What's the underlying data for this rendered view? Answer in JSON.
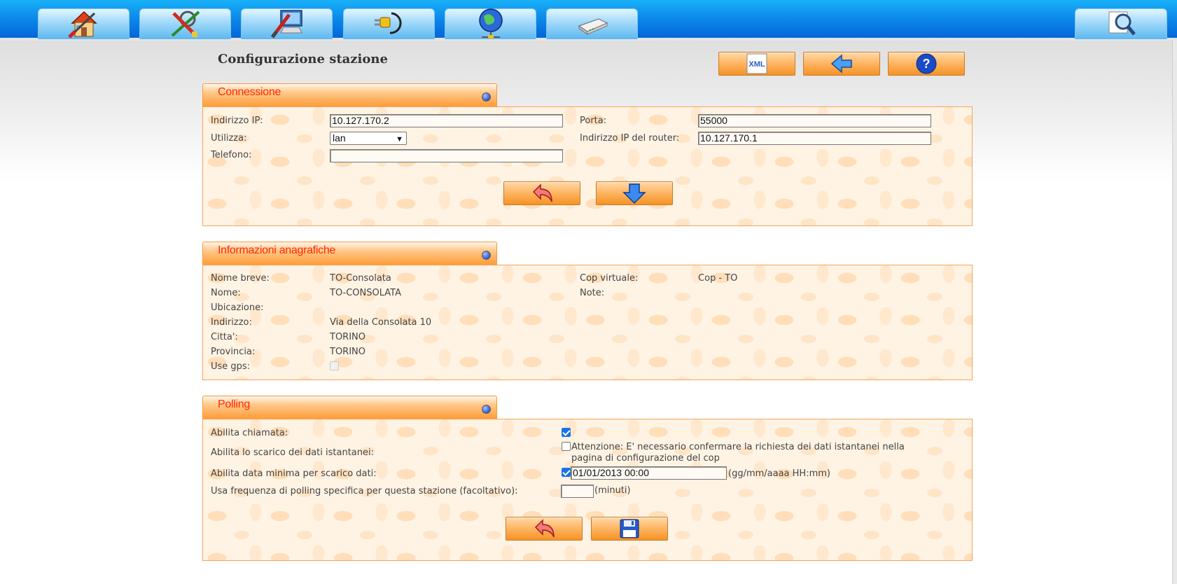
{
  "nav": {
    "tabs": [
      {
        "icon": "home-icon"
      },
      {
        "icon": "tools-icon"
      },
      {
        "icon": "computer-config-icon"
      },
      {
        "icon": "plug-icon"
      },
      {
        "icon": "network-globe-icon"
      },
      {
        "icon": "modem-icon"
      }
    ],
    "search_icon": "magnifier-icon"
  },
  "page": {
    "title": "Configurazione stazione",
    "actions": {
      "xml_label": "XML",
      "back_icon": "arrow-left-icon",
      "help_icon": "help-icon"
    }
  },
  "connessione": {
    "title": "Connessione",
    "ip_label": "Indirizzo IP:",
    "ip_value": "10.127.170.2",
    "porta_label": "Porta:",
    "porta_value": "55000",
    "utilizza_label": "Utilizza:",
    "utilizza_value": "lan",
    "router_label": "Indirizzo IP del router:",
    "router_value": "10.127.170.1",
    "telefono_label": "Telefono:",
    "telefono_value": ""
  },
  "anagrafica": {
    "title": "Informazioni anagrafiche",
    "rows_left": [
      {
        "label": "Nome breve:",
        "value": "TO-Consolata"
      },
      {
        "label": "Nome:",
        "value": "TO-CONSOLATA"
      },
      {
        "label": "Ubicazione:",
        "value": ""
      },
      {
        "label": "Indirizzo:",
        "value": "Via della Consolata 10"
      },
      {
        "label": "Citta':",
        "value": "TORINO"
      },
      {
        "label": "Provincia:",
        "value": "TORINO"
      },
      {
        "label": "Use gps:",
        "value": ""
      }
    ],
    "rows_right": [
      {
        "label": "Cop virtuale:",
        "value": "Cop - TO"
      },
      {
        "label": "Note:",
        "value": ""
      }
    ],
    "use_gps_checked": false
  },
  "polling": {
    "title": "Polling",
    "abilita_chiamata_label": "Abilita chiamata:",
    "abilita_chiamata_checked": true,
    "scarico_istantanei_label": "Abilita lo scarico dei dati istantanei:",
    "scarico_istantanei_checked": false,
    "attenzione_line1": "Attenzione: E' necessario confermare la richiesta dei dati istantanei nella",
    "attenzione_line2": "pagina di configurazione del cop",
    "data_minima_label": "Abilita data minima per scarico dati:",
    "data_minima_checked": true,
    "data_minima_value": "01/01/2013 00:00",
    "data_minima_format": "(gg/mm/aaaa HH:mm)",
    "frequenza_label": "Usa frequenza di polling specifica per questa stazione (facoltativo):",
    "frequenza_value": "",
    "frequenza_unit": "(minuti)"
  },
  "colors": {
    "header_blue": "#0b84e8",
    "section_title": "#ff2a00",
    "section_orange": "#ff9a35"
  }
}
